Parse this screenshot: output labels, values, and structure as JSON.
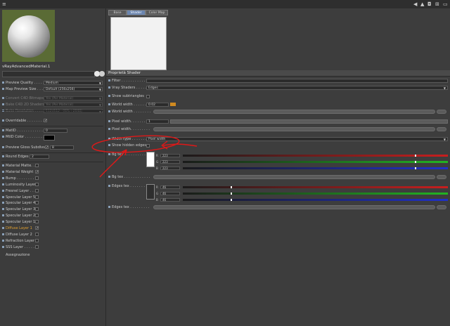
{
  "titlebar": {
    "icons": [
      "menu-icon",
      "back-icon",
      "up-icon",
      "lock-icon",
      "expand-icon",
      "close-icon"
    ]
  },
  "material": {
    "name": "vRayAdvancedMaterial.1",
    "preview_bg": "#5a6b35"
  },
  "left_settings": [
    {
      "label": "Preview Quality . . . . .",
      "value": "Medium",
      "kind": "dropdown",
      "dim": false
    },
    {
      "label": "Map Preview Size . . .",
      "value": "Default (256x256)",
      "kind": "dropdown",
      "dim": false
    },
    {
      "label": "Convert C4D Bitmaps",
      "value": "Yes (Per Material)",
      "kind": "dropdown",
      "dim": true
    },
    {
      "label": "Bake C4D 2D Shaders",
      "value": "Yes (Per Material)",
      "kind": "dropdown",
      "dim": true
    },
    {
      "label": "Bake Resolution . . . .",
      "value": "512x512 - 96% : 2048)",
      "kind": "dropdown",
      "dim": true
    }
  ],
  "overridable": {
    "label": "Overridable . . . . . . . .",
    "checked": "✓"
  },
  "matid": {
    "label": "MatID . . . . . . . . . . . .",
    "value": "0"
  },
  "mtid_color": {
    "label": "MtID Color . . . . . . . . .",
    "color": "#000000"
  },
  "preview_gloss": {
    "label": "Preview Gloss Subdivs",
    "checked": "✓",
    "value": "8"
  },
  "round_edges": {
    "label": "Round Edges",
    "value": "2"
  },
  "layers": [
    {
      "label": "Material Matte. . .",
      "checked": "",
      "highlight": false
    },
    {
      "label": "Material Weight",
      "checked": "✓",
      "highlight": false
    },
    {
      "label": "Bump . . . . . . . . . .",
      "checked": "",
      "highlight": false
    },
    {
      "label": "Luminosity Layer",
      "checked": "",
      "highlight": false
    },
    {
      "label": "Fresnel Layer . . .",
      "checked": "",
      "highlight": false
    },
    {
      "label": "Specular Layer 5",
      "checked": "",
      "highlight": false
    },
    {
      "label": "Specular Layer 4",
      "checked": "",
      "highlight": false
    },
    {
      "label": "Specular Layer 3",
      "checked": "",
      "highlight": false
    },
    {
      "label": "Specular Layer 2",
      "checked": "",
      "highlight": false
    },
    {
      "label": "Specular Layer 1",
      "checked": "",
      "highlight": false
    },
    {
      "label": "Diffuse Layer 1",
      "checked": "✓",
      "highlight": true
    },
    {
      "label": "Diffuse Layer 2",
      "checked": "",
      "highlight": false
    },
    {
      "label": "Refraction Layer",
      "checked": "",
      "highlight": false
    },
    {
      "label": "SSS Layer . . . . . . .",
      "checked": "",
      "highlight": false
    }
  ],
  "assignment": "Assegnazione",
  "tabs": [
    {
      "label": "Base",
      "active": false
    },
    {
      "label": "Shader",
      "active": true
    },
    {
      "label": "Color Map",
      "active": false
    }
  ],
  "section_title": "Proprietà Shader",
  "shader": {
    "filter_label": "Filter . . . . . . . . . . . . .",
    "vray_shaders_label": "Vray Shaders . . . . . . .",
    "vray_shaders_value": "Edges",
    "show_subtriangles_label": "Show subtriangles",
    "world_width_label": "World width . . . . . . . .",
    "world_width_value": "0.02",
    "world_width_2_label": "World width . . . . . . . .",
    "pixel_width_label": "Pixel width. . . . . . . . .",
    "pixel_width_value": "1",
    "pixel_width_2_label": "Pixel width. . . . . . . . .",
    "width_type_label": "Width type . . . . . . . .",
    "width_type_value": "Pixel width",
    "show_hidden_label": "Show hidden edges",
    "bg_tex_label": "Bg tex . . . . . . . . . . . .",
    "bg_color": {
      "r": "223",
      "g": "223",
      "b": "223",
      "r_label": "R",
      "g_label": "G",
      "b_label": "B",
      "level": 0.875
    },
    "bg_tex_2_label": "Bg tex . . . . . . . . . . . .",
    "edges_tex_label": "Edges tex . . . . . . . . .",
    "edges_color": {
      "r": "46",
      "g": "46",
      "b": "46",
      "r_label": "R",
      "g_label": "G",
      "b_label": "B",
      "level": 0.18
    },
    "edges_tex_2_label": "Edges tex . . . . . . . . ."
  },
  "colors": {
    "accent_tab": "#6b86b0",
    "highlight_text": "#e0a030",
    "annotation_red": "#e01818",
    "slider_orange": "#d08a20"
  }
}
